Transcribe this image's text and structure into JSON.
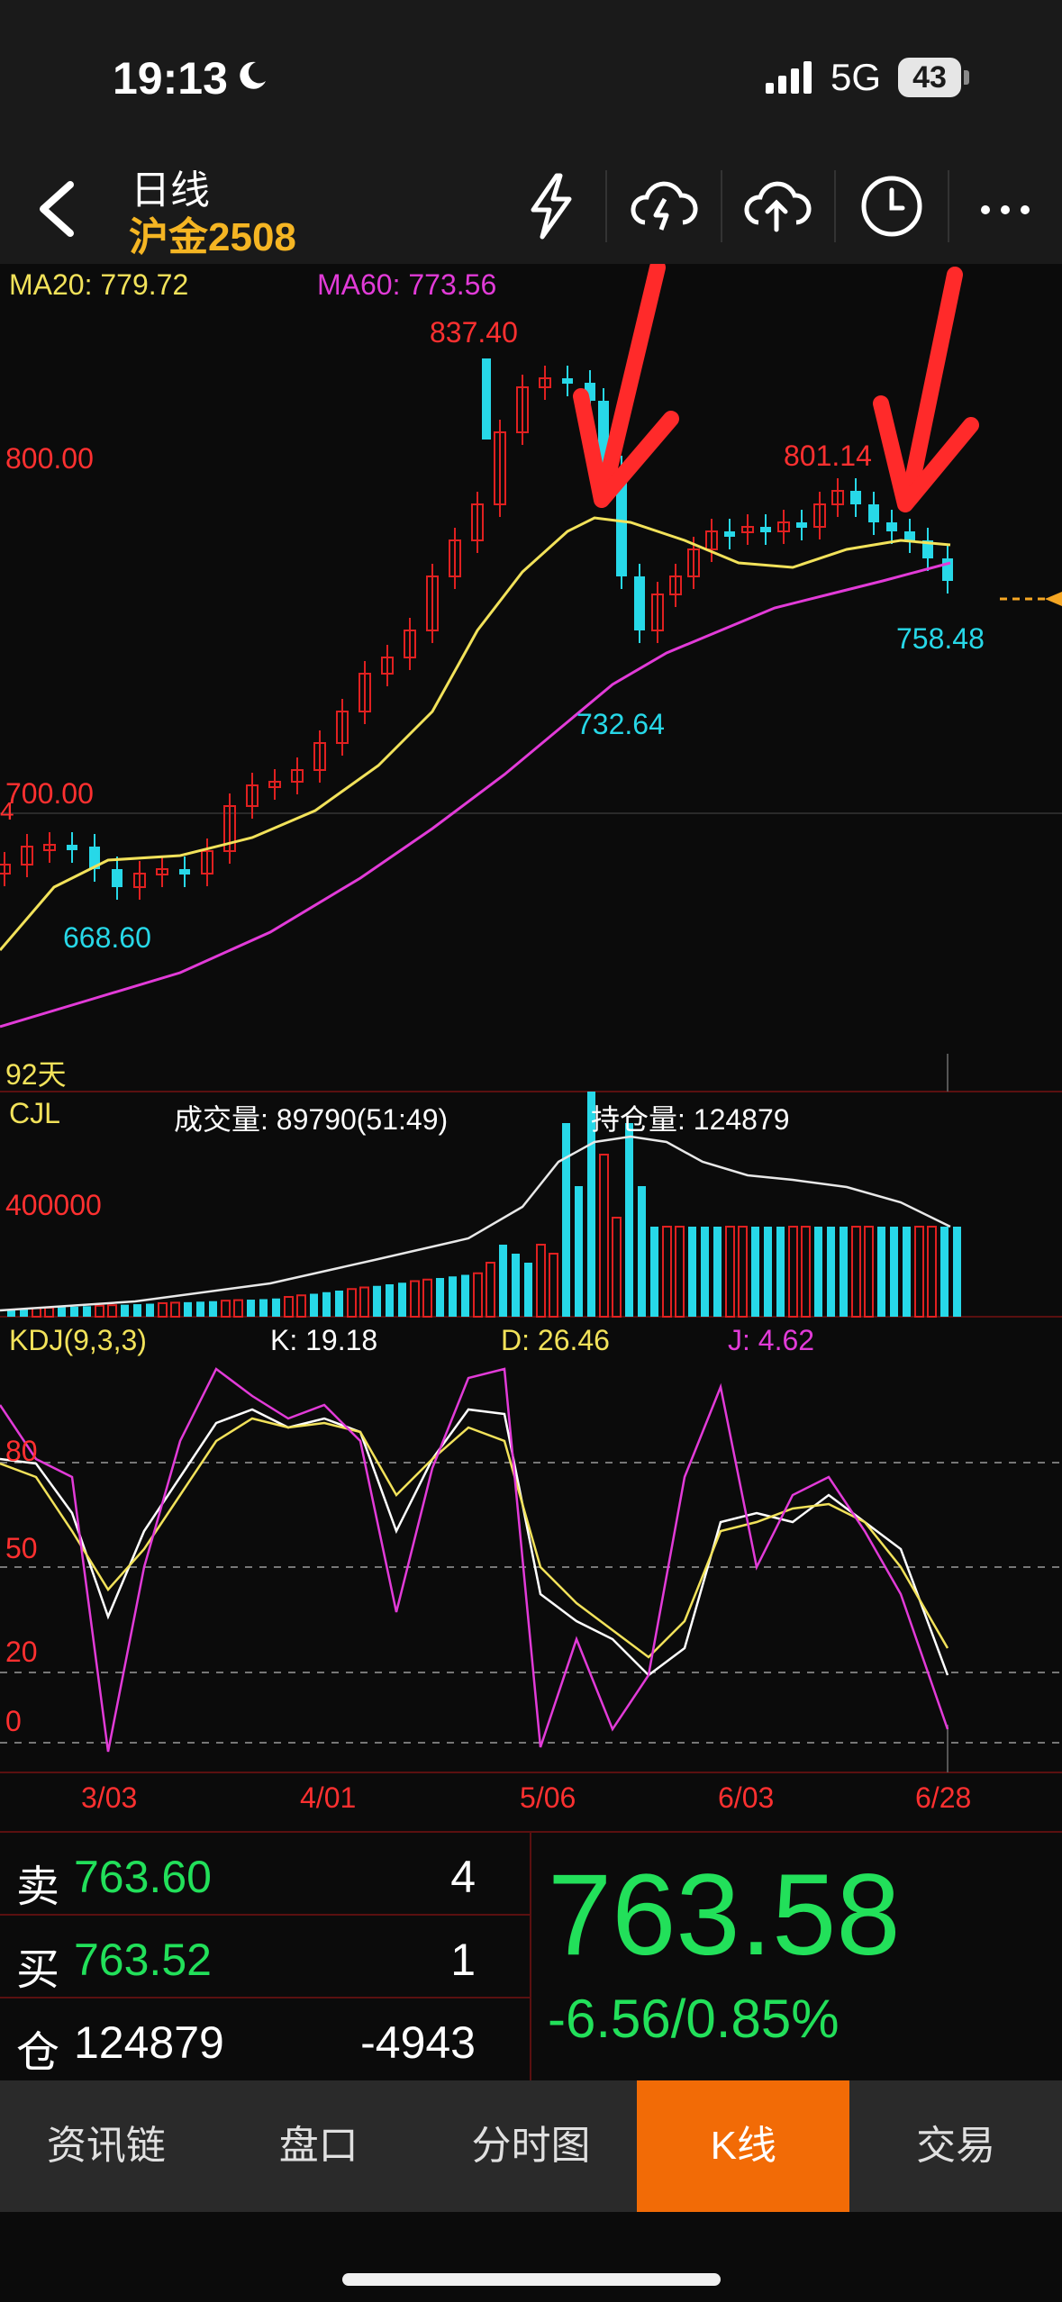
{
  "status": {
    "time": "19:13",
    "network": "5G",
    "battery": "43"
  },
  "header": {
    "title": "日线",
    "symbol": "沪金2508"
  },
  "ma": {
    "ma20_label": "MA20: 779.72",
    "ma60_label": "MA60: 773.56"
  },
  "price_labels": {
    "high": "837.40",
    "p800": "800.00",
    "peak2": "801.14",
    "last": "758.48",
    "low1": "732.64",
    "p700": "700.00",
    "low2": "668.60",
    "days": "92天",
    "edge": "4"
  },
  "volume": {
    "title": "CJL",
    "vol_label": "成交量: 89790(51:49)",
    "oi_label": "持仓量: 124879",
    "axis": "400000"
  },
  "kdj": {
    "title": "KDJ(9,3,3)",
    "k": "K: 19.18",
    "d": "D: 26.46",
    "j": "J: 4.62",
    "levels": [
      "80",
      "50",
      "20",
      "0"
    ]
  },
  "dates": [
    "3/03",
    "4/01",
    "5/06",
    "6/03",
    "6/28"
  ],
  "quote": {
    "sell_label": "卖",
    "sell_price": "763.60",
    "sell_qty": "4",
    "buy_label": "买",
    "buy_price": "763.52",
    "buy_qty": "1",
    "oi_label": "仓",
    "oi_value": "124879",
    "oi_change": "-4943",
    "last_price": "763.58",
    "change": "-6.56/0.85%"
  },
  "tabs": [
    {
      "label": "资讯链"
    },
    {
      "label": "盘口"
    },
    {
      "label": "分时图"
    },
    {
      "label": "K线"
    },
    {
      "label": "交易"
    }
  ],
  "colors": {
    "up": "#e02020",
    "down": "#27d8e8",
    "ma20": "#f2e25a",
    "ma60": "#e23bd8",
    "accent": "#f26b06",
    "green": "#22e05a"
  },
  "chart_data": {
    "type": "candlestick",
    "title": "沪金2508 日线",
    "y_labels": [
      "800.00",
      "700.00"
    ],
    "annotations": {
      "high": 837.4,
      "low_may": 732.64,
      "peak_jun": 801.14,
      "low_mar": 668.6,
      "last": 758.48
    },
    "ma20": 779.72,
    "ma60": 773.56,
    "x": [
      "3/03",
      "4/01",
      "5/06",
      "6/03",
      "6/28"
    ]
  }
}
